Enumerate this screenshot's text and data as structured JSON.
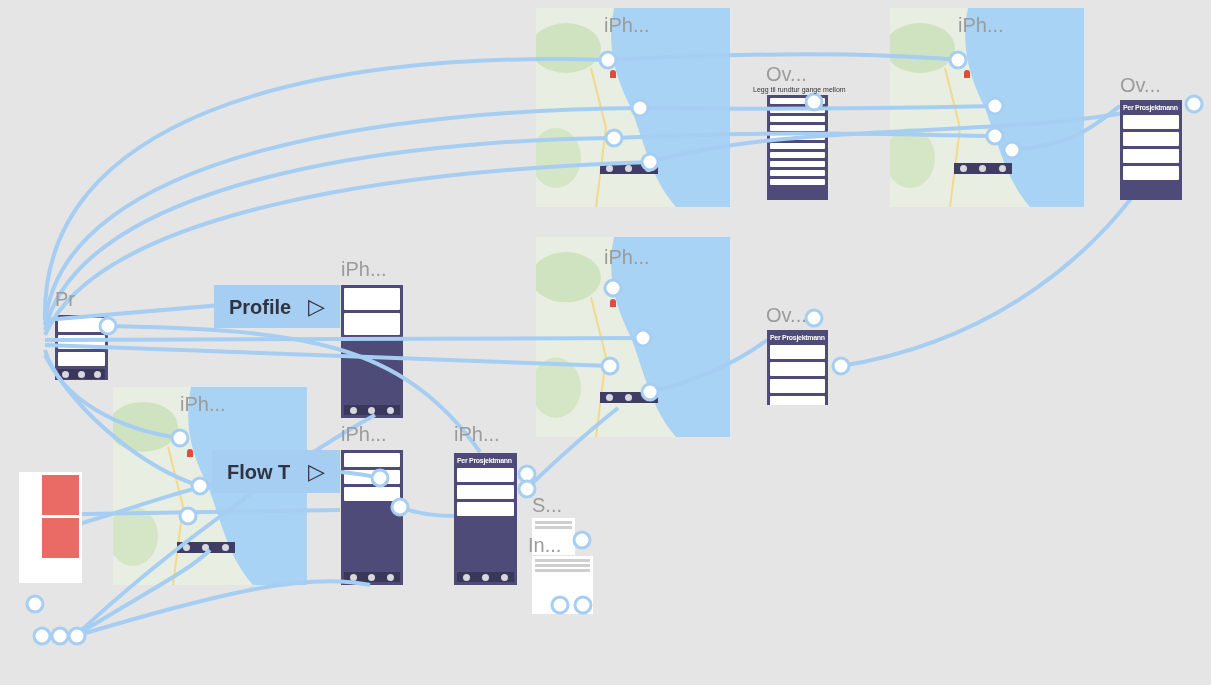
{
  "canvas": {
    "frames": [
      {
        "title": "iPh...",
        "kind": "map"
      },
      {
        "title": "Ov...",
        "kind": "list",
        "caption": "Legg til rundtur gange mellom"
      },
      {
        "title": "iPh...",
        "kind": "map"
      },
      {
        "title": "Ov...",
        "kind": "summary",
        "heading": "Per Prosjektmann"
      },
      {
        "title": "iPh...",
        "kind": "map"
      },
      {
        "title": "Ov...",
        "kind": "summary",
        "heading": "Per Prosjektmann"
      },
      {
        "title": "iPh...",
        "kind": "profile"
      },
      {
        "title": "iPh...",
        "kind": "map"
      },
      {
        "title": "iPh...",
        "kind": "cards"
      },
      {
        "title": "iPh...",
        "kind": "project",
        "heading": "Per Prosjektmann"
      },
      {
        "title": "S...",
        "kind": "dialog"
      },
      {
        "title": "In...",
        "kind": "dialog"
      },
      {
        "title": "Pr",
        "kind": "cards"
      }
    ],
    "flow_starts": [
      {
        "label": "Profile",
        "icon": "▷"
      },
      {
        "label": "Flow T",
        "icon": "▷"
      }
    ]
  }
}
